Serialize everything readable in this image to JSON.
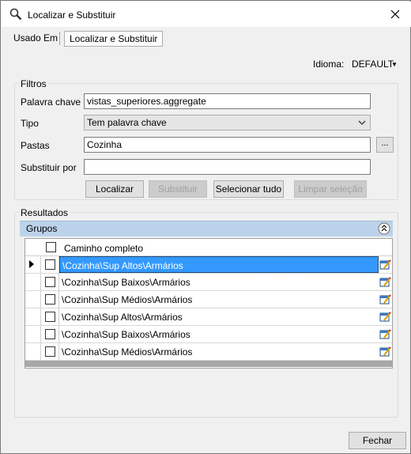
{
  "window": {
    "title": "Localizar e Substituir"
  },
  "tabs": [
    {
      "label": "Usado Em"
    },
    {
      "label": "Localizar e Substituir"
    }
  ],
  "idioma": {
    "label": "Idioma:",
    "value": "DEFAULT"
  },
  "filtros": {
    "title": "Filtros",
    "palavra_chave": {
      "label": "Palavra chave",
      "value": "vistas_superiores.aggregate"
    },
    "tipo": {
      "label": "Tipo",
      "value": "Tem palavra chave"
    },
    "pastas": {
      "label": "Pastas",
      "value": "Cozinha",
      "browse_label": "..."
    },
    "substituir_por": {
      "label": "Substituir por",
      "value": ""
    },
    "buttons": {
      "localizar": "Localizar",
      "substituir": "Substituir",
      "selecionar_tudo": "Selecionar tudo",
      "limpar_selecao": "Limpar seleção"
    }
  },
  "resultados": {
    "title": "Resultados",
    "group_label": "Grupos",
    "column_header": "Caminho completo",
    "rows": [
      {
        "path": "\\Cozinha\\Sup Altos\\Armários",
        "selected": true
      },
      {
        "path": "\\Cozinha\\Sup Baixos\\Armários",
        "selected": false
      },
      {
        "path": "\\Cozinha\\Sup Médios\\Armários",
        "selected": false
      },
      {
        "path": "\\Cozinha\\Sup Altos\\Armários",
        "selected": false
      },
      {
        "path": "\\Cozinha\\Sup Baixos\\Armários",
        "selected": false
      },
      {
        "path": "\\Cozinha\\Sup Médios\\Armários",
        "selected": false
      }
    ]
  },
  "footer": {
    "fechar": "Fechar"
  },
  "colors": {
    "selection": "#3399ff",
    "group_bar": "#bcd2ea"
  }
}
